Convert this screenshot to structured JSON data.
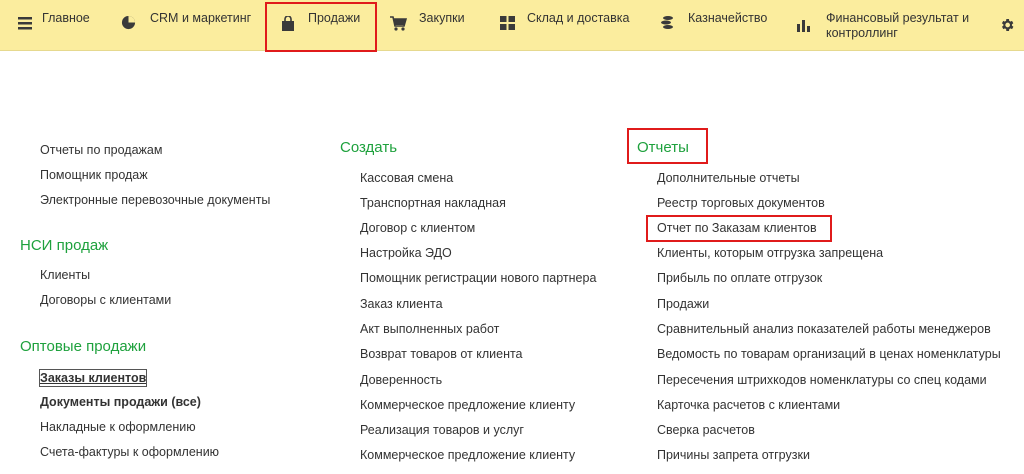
{
  "topbar": {
    "sections": [
      {
        "label": "Главное",
        "icon": "hamburger-menu-icon"
      },
      {
        "label": "CRM и маркетинг",
        "icon": "pie-chart-icon"
      },
      {
        "label": "Продажи",
        "icon": "shopping-bag-icon"
      },
      {
        "label": "Закупки",
        "icon": "cart-icon"
      },
      {
        "label": "Склад и доставка",
        "icon": "warehouse-icon"
      },
      {
        "label": "Казначейство",
        "icon": "coins-icon"
      },
      {
        "label": "Финансовый результат и контроллинг",
        "icon": "bar-chart-icon"
      }
    ],
    "settings_icon": "gear-icon",
    "accent": "#fbed9e",
    "highlight_color": "#e01b1b"
  },
  "col1": {
    "items": [
      "Отчеты по продажам",
      "Помощник продаж",
      "Электронные перевозочные документы"
    ],
    "groups": [
      {
        "title": "НСИ продаж",
        "items": [
          "Клиенты",
          "Договоры с клиентами"
        ]
      },
      {
        "title": "Оптовые продажи",
        "items": [
          "Заказы клиентов",
          "Документы продажи (все)",
          "Накладные к оформлению",
          "Счета-фактуры к оформлению"
        ]
      }
    ]
  },
  "col2": {
    "title": "Создать",
    "items": [
      "Кассовая смена",
      "Транспортная накладная",
      "Договор с клиентом",
      "Настройка ЭДО",
      "Помощник регистрации нового партнера",
      "Заказ клиента",
      "Акт выполненных работ",
      "Возврат товаров от клиента",
      "Доверенность",
      "Коммерческое предложение клиенту",
      "Реализация товаров и услуг",
      "Коммерческое предложение клиенту"
    ]
  },
  "col3": {
    "title": "Отчеты",
    "items": [
      "Дополнительные отчеты",
      "Реестр торговых документов",
      "Отчет по Заказам клиентов",
      "Клиенты, которым отгрузка запрещена",
      "Прибыль по оплате отгрузок",
      "Продажи",
      "Сравнительный анализ показателей работы менеджеров",
      "Ведомость по товарам организаций в ценах номенклатуры",
      "Пересечения штрихкодов номенклатуры со спец кодами",
      "Карточка расчетов с клиентами",
      "Сверка расчетов",
      "Причины запрета отгрузки"
    ]
  },
  "colors": {
    "group_title": "#1ea13d",
    "text": "#333333"
  }
}
